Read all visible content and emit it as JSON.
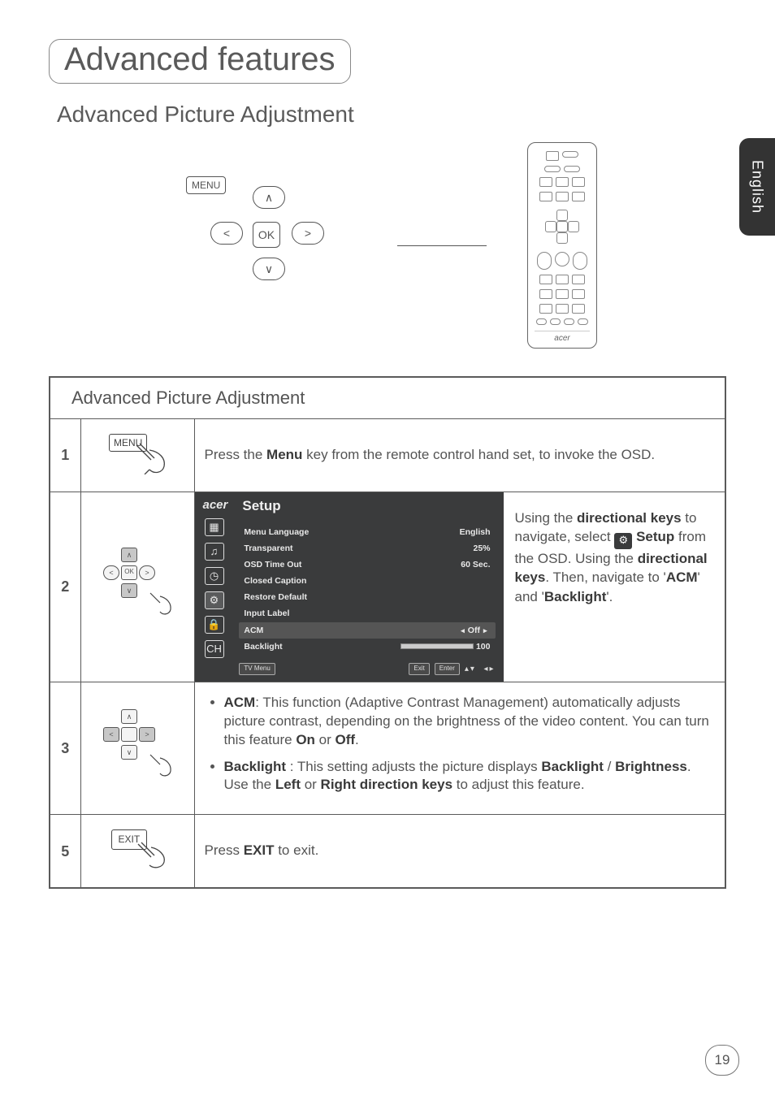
{
  "side_tab": "English",
  "title": "Advanced features",
  "subtitle": "Advanced Picture Adjustment",
  "page_number": "19",
  "buttons": {
    "menu": "MENU",
    "ok": "OK",
    "exit": "EXIT",
    "up": "∧",
    "down": "∨",
    "left": "<",
    "right": ">"
  },
  "remote_brand": "acer",
  "table": {
    "header": "Advanced Picture Adjustment",
    "step1": {
      "num": "1",
      "desc_pre": "Press the ",
      "desc_bold": "Menu",
      "desc_post": " key from the remote control hand set, to invoke the OSD."
    },
    "step2": {
      "num": "2",
      "osd": {
        "brand": "acer",
        "heading": "Setup",
        "rows": {
          "lang_l": "Menu Language",
          "lang_v": "English",
          "trans_l": "Transparent",
          "trans_v": "25%",
          "to_l": "OSD Time Out",
          "to_v": "60 Sec.",
          "cc_l": "Closed Caption",
          "rd_l": "Restore Default",
          "il_l": "Input Label",
          "acm_l": "ACM",
          "acm_v": "Off",
          "bl_l": "Backlight",
          "bl_v": "100"
        },
        "foot": {
          "menu": "TV Menu",
          "exit": "Exit",
          "enter": "Enter"
        }
      },
      "desc": {
        "p1a": "Using the ",
        "p1b": "directional keys",
        "p1c": " to navigate, select ",
        "p1d": "Setup",
        "p1e": " from the OSD. Using the ",
        "p1f": "directional keys",
        "p1g": ". Then, navigate to '",
        "p1h": "ACM",
        "p1i": "' and '",
        "p1j": "Backlight",
        "p1k": "'."
      }
    },
    "step3": {
      "num": "3",
      "li1": {
        "b1": "ACM",
        "t1": ": This function (Adaptive Contrast Management) automatically adjusts picture contrast, depending on the brightness of the video content. You can turn this feature ",
        "b2": "On",
        "t2": " or ",
        "b3": "Off",
        "t3": "."
      },
      "li2": {
        "b1": "Backlight",
        "t1": " : This setting adjusts the picture displays ",
        "b2": "Backlight",
        "t2": " / ",
        "b3": "Brightness",
        "t3": ". Use the ",
        "b4": "Left",
        "t4": " or ",
        "b5": "Right direction keys",
        "t5": " to adjust this feature."
      }
    },
    "step5": {
      "num": "5",
      "t1": "Press ",
      "b1": "EXIT",
      "t2": " to exit."
    }
  }
}
